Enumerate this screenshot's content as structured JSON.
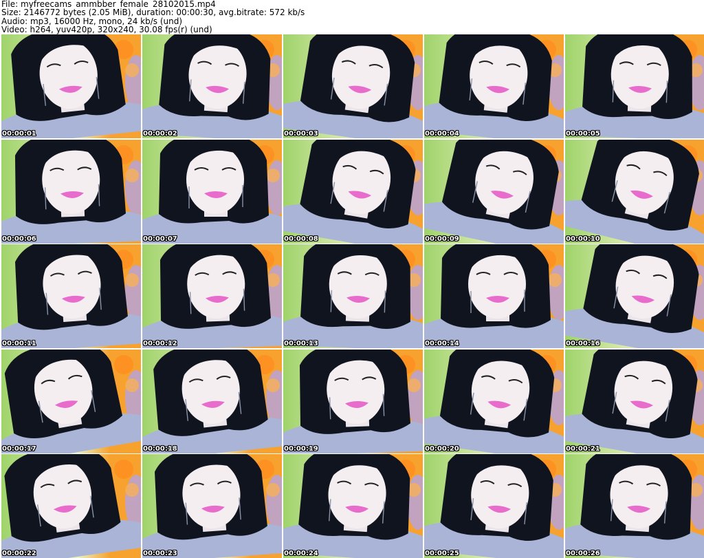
{
  "header": {
    "file_line": "File: myfreecams_ammbber_female_28102015.mp4",
    "size_line": "Size: 2146772 bytes (2.05 MiB), duration: 00:00:30, avg.bitrate: 572 kb/s",
    "audio_line": "Audio: mp3, 16000 Hz, mono, 24 kb/s (und)",
    "video_line": "Video: h264, yuv420p, 320x240, 30.08 fps(r) (und)"
  },
  "colors": {
    "background": "#ffffff",
    "hair": "#10141f",
    "skin": "#f4eef0",
    "lips": "#e86ccc",
    "sweater": "#aab4d6",
    "bg_green": "#9fd36a",
    "bg_orange": "#f7a12e",
    "bg_purple": "#b7a3d8",
    "timestamp_text": "#ffffff",
    "timestamp_outline": "#000000"
  },
  "thumbnails": [
    {
      "timestamp": "00:00:01"
    },
    {
      "timestamp": "00:00:02"
    },
    {
      "timestamp": "00:00:03"
    },
    {
      "timestamp": "00:00:04"
    },
    {
      "timestamp": "00:00:05"
    },
    {
      "timestamp": "00:00:06"
    },
    {
      "timestamp": "00:00:07"
    },
    {
      "timestamp": "00:00:08"
    },
    {
      "timestamp": "00:00:09"
    },
    {
      "timestamp": "00:00:10"
    },
    {
      "timestamp": "00:00:11"
    },
    {
      "timestamp": "00:00:12"
    },
    {
      "timestamp": "00:00:13"
    },
    {
      "timestamp": "00:00:14"
    },
    {
      "timestamp": "00:00:16"
    },
    {
      "timestamp": "00:00:17"
    },
    {
      "timestamp": "00:00:18"
    },
    {
      "timestamp": "00:00:19"
    },
    {
      "timestamp": "00:00:20"
    },
    {
      "timestamp": "00:00:21"
    },
    {
      "timestamp": "00:00:22"
    },
    {
      "timestamp": "00:00:23"
    },
    {
      "timestamp": "00:00:24"
    },
    {
      "timestamp": "00:00:25"
    },
    {
      "timestamp": "00:00:26"
    }
  ]
}
